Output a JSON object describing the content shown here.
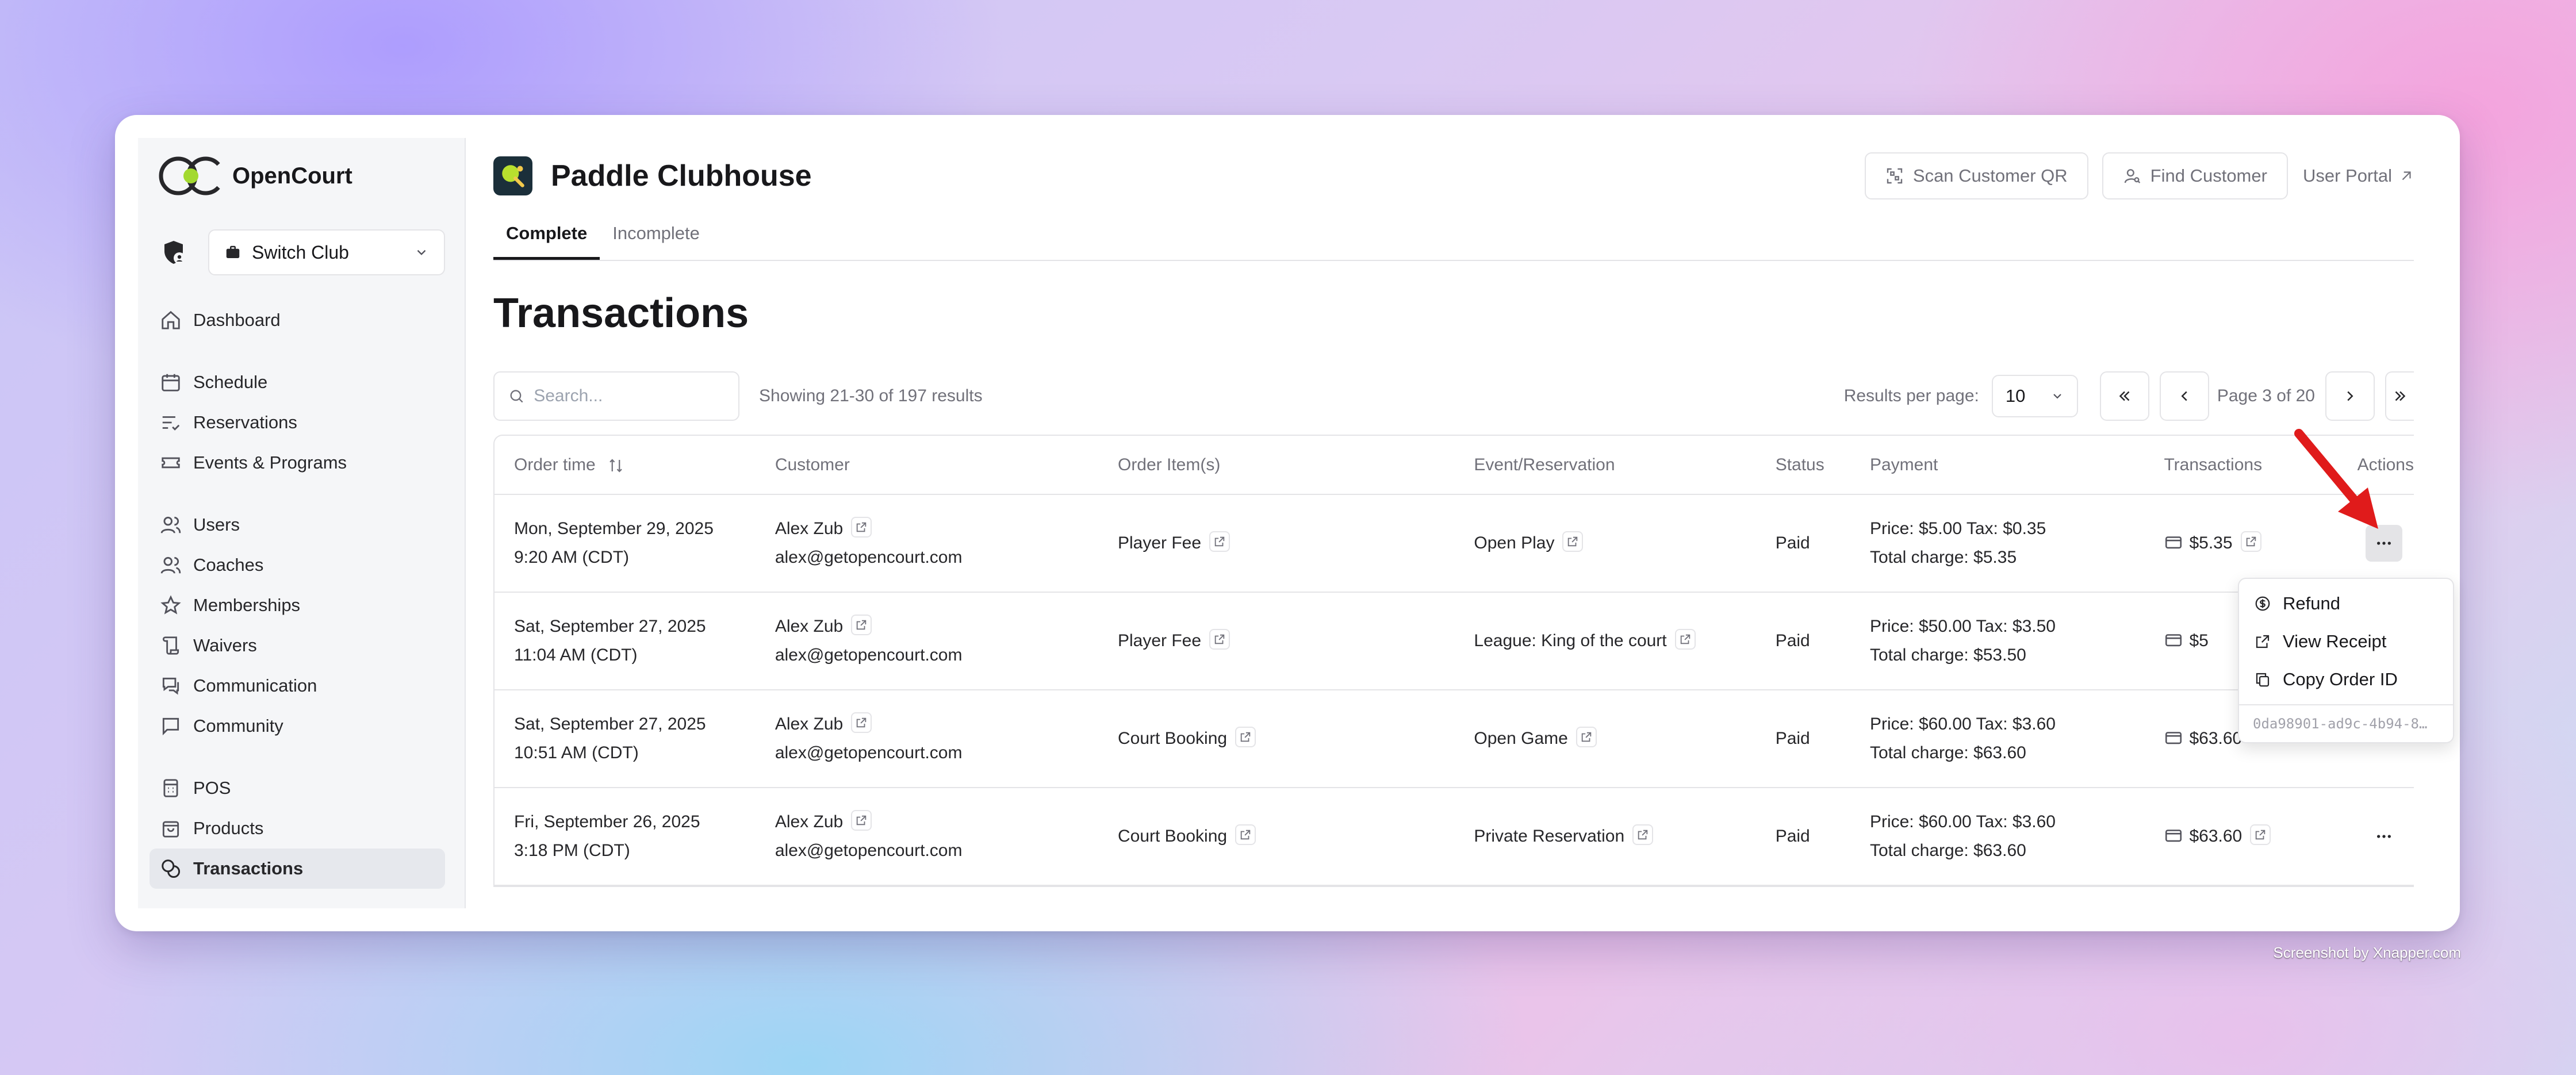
{
  "brand": {
    "name": "OpenCourt"
  },
  "club_switcher": {
    "label": "Switch Club"
  },
  "sidebar": {
    "groups": [
      [
        {
          "label": "Dashboard",
          "icon": "home-icon"
        }
      ],
      [
        {
          "label": "Schedule",
          "icon": "calendar-icon"
        },
        {
          "label": "Reservations",
          "icon": "list-check-icon"
        },
        {
          "label": "Events & Programs",
          "icon": "ticket-icon"
        }
      ],
      [
        {
          "label": "Users",
          "icon": "users-icon"
        },
        {
          "label": "Coaches",
          "icon": "coach-icon"
        },
        {
          "label": "Memberships",
          "icon": "star-icon"
        },
        {
          "label": "Waivers",
          "icon": "scroll-icon"
        },
        {
          "label": "Communication",
          "icon": "chat-icon"
        },
        {
          "label": "Community",
          "icon": "message-square-icon"
        }
      ],
      [
        {
          "label": "POS",
          "icon": "pos-icon"
        },
        {
          "label": "Products",
          "icon": "bag-icon"
        },
        {
          "label": "Transactions",
          "icon": "coins-icon",
          "active": true
        }
      ]
    ]
  },
  "header": {
    "club_name": "Paddle Clubhouse",
    "scan_qr": "Scan Customer QR",
    "find_customer": "Find Customer",
    "user_portal": "User Portal"
  },
  "tabs": [
    {
      "label": "Complete",
      "active": true
    },
    {
      "label": "Incomplete"
    }
  ],
  "page_title": "Transactions",
  "search": {
    "placeholder": "Search...",
    "value": ""
  },
  "results_summary": "Showing 21-30 of 197 results",
  "pagination": {
    "results_per_page_label": "Results per page:",
    "per_page": "10",
    "page_label": "Page 3 of 20"
  },
  "table": {
    "columns": [
      "Order time",
      "Customer",
      "Order Item(s)",
      "Event/Reservation",
      "Status",
      "Payment",
      "Transactions",
      "Actions"
    ],
    "rows": [
      {
        "date": "Mon, September 29, 2025",
        "time": "9:20 AM (CDT)",
        "customer_name": "Alex Zub",
        "customer_email": "alex@getopencourt.com",
        "item": "Player Fee",
        "event": "Open Play",
        "status": "Paid",
        "price_tax": "Price: $5.00 Tax: $0.35",
        "total": "Total charge: $5.35",
        "txn": "$5.35"
      },
      {
        "date": "Sat, September 27, 2025",
        "time": "11:04 AM (CDT)",
        "customer_name": "Alex Zub",
        "customer_email": "alex@getopencourt.com",
        "item": "Player Fee",
        "event": "League: King of the court",
        "status": "Paid",
        "price_tax": "Price: $50.00 Tax: $3.50",
        "total": "Total charge: $53.50",
        "txn": "$5"
      },
      {
        "date": "Sat, September 27, 2025",
        "time": "10:51 AM (CDT)",
        "customer_name": "Alex Zub",
        "customer_email": "alex@getopencourt.com",
        "item": "Court Booking",
        "event": "Open Game",
        "status": "Paid",
        "price_tax": "Price: $60.00 Tax: $3.60",
        "total": "Total charge: $63.60",
        "txn": "$63.60"
      },
      {
        "date": "Fri, September 26, 2025",
        "time": "3:18 PM (CDT)",
        "customer_name": "Alex Zub",
        "customer_email": "alex@getopencourt.com",
        "item": "Court Booking",
        "event": "Private Reservation",
        "status": "Paid",
        "price_tax": "Price: $60.00 Tax: $3.60",
        "total": "Total charge: $63.60",
        "txn": "$63.60"
      }
    ]
  },
  "actions_menu": {
    "items": [
      {
        "label": "Refund",
        "icon": "dollar-circle-icon"
      },
      {
        "label": "View Receipt",
        "icon": "external-link-icon"
      },
      {
        "label": "Copy Order ID",
        "icon": "copy-icon"
      }
    ],
    "order_id": "0da98901-ad9c-4b94-8…"
  },
  "credit": "Screenshot by Xnapper.com"
}
